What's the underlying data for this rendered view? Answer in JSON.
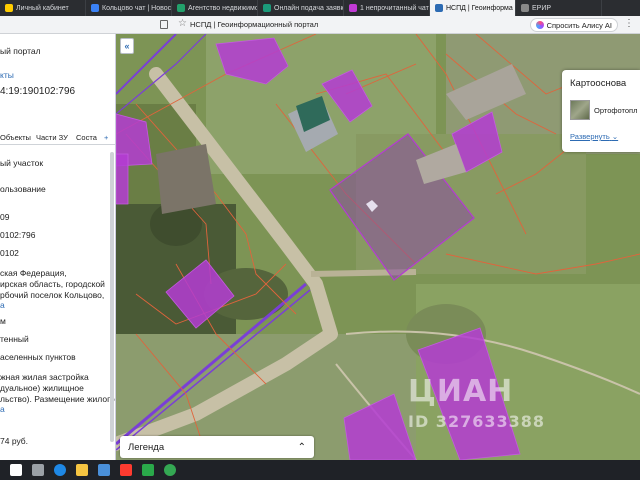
{
  "browser": {
    "tabs": [
      {
        "label": "Личный кабинет",
        "active": false,
        "color": "#ffcc00"
      },
      {
        "label": "Кольцово чат | Новосибир",
        "active": false,
        "color": "#3b82f6"
      },
      {
        "label": "Агентство недвижимост",
        "active": false,
        "color": "#22a06b"
      },
      {
        "label": "Онлайн подача заявки",
        "active": false,
        "color": "#1b9a7a"
      },
      {
        "label": "1 непрочитанный чат",
        "active": false,
        "color": "#c23ad6"
      },
      {
        "label": "НСПД | Геоинформа",
        "active": true,
        "color": "#2d6bb3"
      },
      {
        "label": "ЕРИР",
        "active": false,
        "color": "#888888"
      }
    ],
    "page_title": "НСПД | Геоинформационный портал",
    "alice_label": "Спросить Алису AI"
  },
  "sidebar": {
    "lines": [
      {
        "text": "ый портал",
        "cls": ""
      },
      {
        "text": "кты",
        "cls": "blue"
      },
      {
        "text": "4:19:190102:796",
        "cls": "big"
      },
      {
        "text": "ый участок",
        "cls": ""
      },
      {
        "text": "ользование",
        "cls": ""
      },
      {
        "text": "09",
        "cls": ""
      },
      {
        "text": "0102:796",
        "cls": ""
      },
      {
        "text": "0102",
        "cls": ""
      },
      {
        "text": "ская Федерация,",
        "cls": ""
      },
      {
        "text": "ирская область, городской",
        "cls": ""
      },
      {
        "text": "рбочий поселок Кольцово,",
        "cls": ""
      },
      {
        "text": "а",
        "cls": "blue"
      },
      {
        "text": "м",
        "cls": ""
      },
      {
        "text": "тенный",
        "cls": ""
      },
      {
        "text": "аселенных пунктов",
        "cls": ""
      },
      {
        "text": "жная жилая застройка",
        "cls": ""
      },
      {
        "text": "дуальное) жилищное",
        "cls": ""
      },
      {
        "text": "льство). Размещение жилого",
        "cls": ""
      },
      {
        "text": "а",
        "cls": "blue"
      },
      {
        "text": "74 руб.",
        "cls": ""
      }
    ],
    "tabs": [
      "Объекты",
      "Части ЗУ",
      "Соста"
    ],
    "tab_more": "+"
  },
  "map": {
    "collapse_icon": "chevron-double-left-icon",
    "legend_label": "Легенда",
    "basemap": {
      "title": "Картооснова",
      "layer": "Ортофотопл",
      "expand_label": "Развернуть"
    },
    "watermark": {
      "brand": "ЦИАН",
      "id": "ID 327633388"
    },
    "colors": {
      "parcel_border": "#e0643c",
      "building_fill": "#b43cd2",
      "selected_fill": "#8a4ea0",
      "road_line": "#7a3fd6"
    }
  },
  "taskbar": {
    "icons": [
      "search-icon",
      "taskview-icon",
      "edge-icon",
      "folder-icon",
      "mail-icon",
      "yandex-icon",
      "chat-icon",
      "chrome-icon"
    ],
    "time": ""
  }
}
